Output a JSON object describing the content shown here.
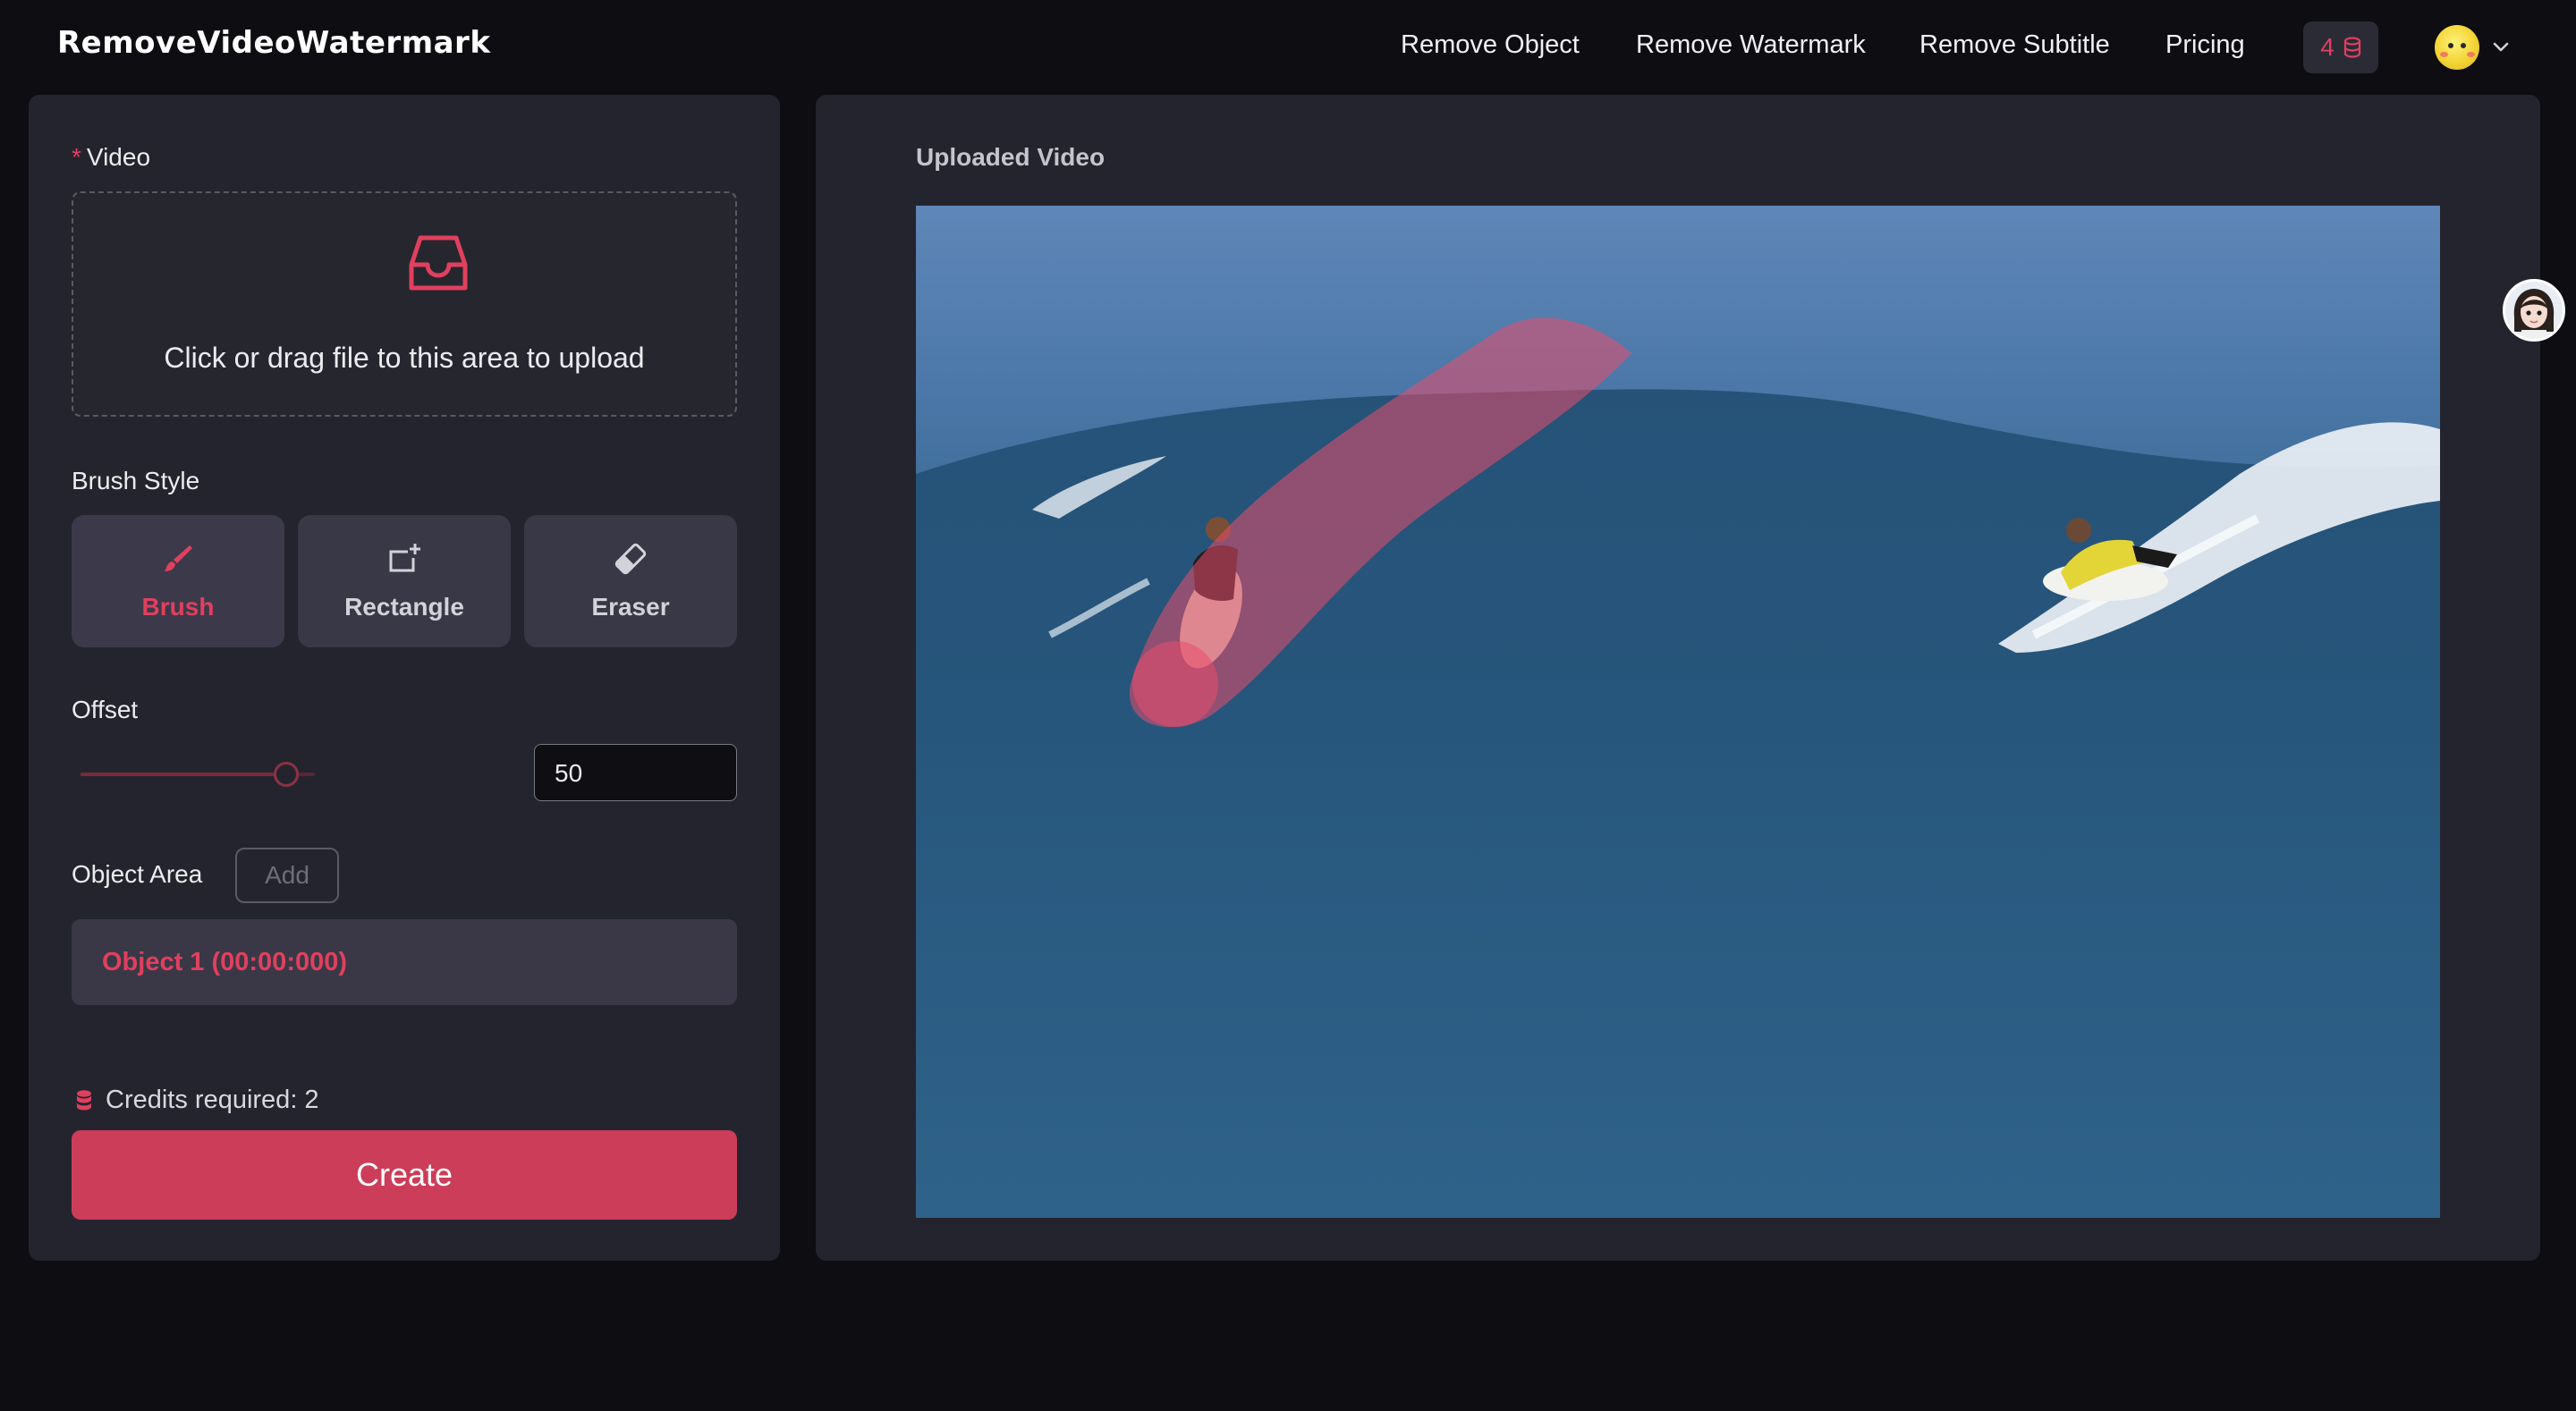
{
  "header": {
    "logo": "RemoveVideoWatermark",
    "nav": [
      "Remove Object",
      "Remove Watermark",
      "Remove Subtitle",
      "Pricing"
    ],
    "credits_count": "4",
    "credits_icon": "database-icon",
    "account_icon": "avatar-icon"
  },
  "sidebar": {
    "video_label": "Video",
    "required_mark": "*",
    "upload_text": "Click or drag file to this area to upload",
    "brush_style_label": "Brush Style",
    "brush_options": [
      "Brush",
      "Rectangle",
      "Eraser"
    ],
    "active_brush": "Brush",
    "offset_label": "Offset",
    "offset_value": "50",
    "object_area_label": "Object Area",
    "add_label": "Add",
    "objects": [
      "Object 1 (00:00:000)"
    ],
    "credits_text": "Credits required: 2",
    "create_label": "Create"
  },
  "main": {
    "title": "Uploaded Video"
  },
  "colors": {
    "accent": "#e0405e",
    "create_button": "#cc3d5a",
    "panel_bg": "#24242e",
    "page_bg": "#0d0d12"
  }
}
